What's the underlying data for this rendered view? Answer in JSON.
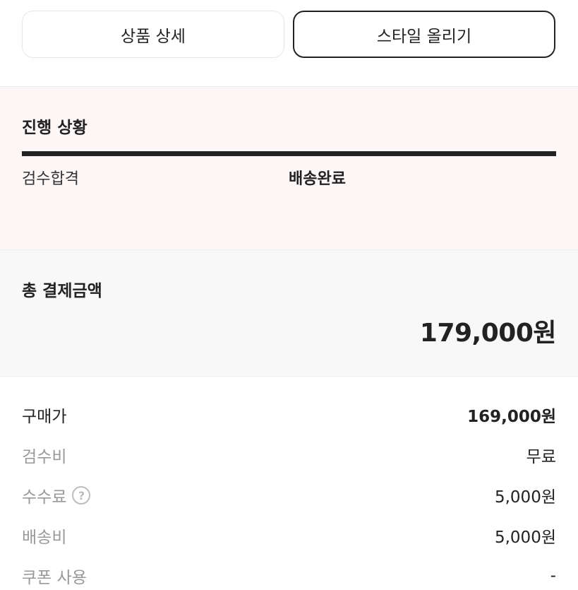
{
  "tabs": {
    "detail_label": "상품 상세",
    "style_label": "스타일 올리기"
  },
  "progress": {
    "title": "진행 상황",
    "steps": [
      {
        "label": "검수합격",
        "state": "done"
      },
      {
        "label": "배송완료",
        "state": "current"
      }
    ]
  },
  "total": {
    "label": "총 결제금액",
    "amount": "179,000원"
  },
  "breakdown": [
    {
      "label": "구매가",
      "value": "169,000원"
    },
    {
      "label": "검수비",
      "value": "무료"
    },
    {
      "label": "수수료",
      "value": "5,000원",
      "help": "?"
    },
    {
      "label": "배송비",
      "value": "5,000원"
    },
    {
      "label": "쿠폰 사용",
      "value": "-"
    }
  ],
  "colors": {
    "progress_bg": "#fdf7f7",
    "total_bg": "#f8f8f8",
    "accent": "#222222",
    "muted": "#999999"
  }
}
